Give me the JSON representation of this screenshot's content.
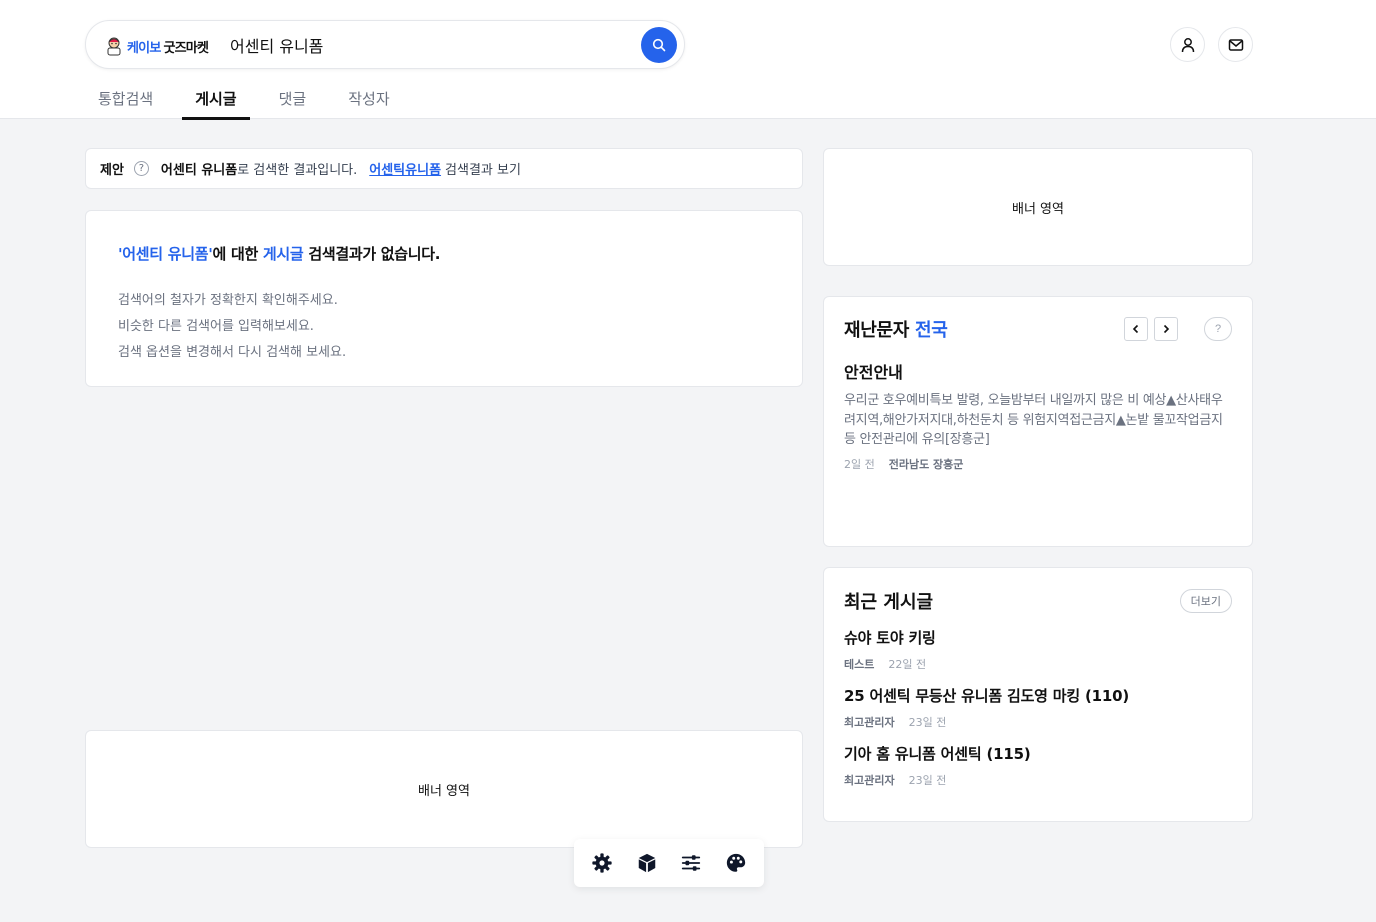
{
  "header": {
    "logo_part1": "케이보",
    "logo_part2": "굿즈마켓",
    "search_value": "어센티 유니폼"
  },
  "tabs": [
    {
      "label": "통합검색",
      "active": false
    },
    {
      "label": "게시글",
      "active": true
    },
    {
      "label": "댓글",
      "active": false
    },
    {
      "label": "작성자",
      "active": false
    }
  ],
  "suggestion": {
    "label": "제안",
    "help": "?",
    "query": "어센티 유니폼",
    "middle": "로 검색한 결과입니다.",
    "link": "어센틱유니폼",
    "tail": "검색결과 보기"
  },
  "no_result": {
    "q_open": "'",
    "query": "어센티 유니폼",
    "q_close": "'",
    "part1": "에 대한 ",
    "category": "게시글",
    "part2": " 검색결과가 없습니다.",
    "tips": [
      "검색어의 철자가 정확한지 확인해주세요.",
      "비슷한 다른 검색어를 입력해보세요.",
      "검색 옵션을 변경해서 다시 검색해 보세요."
    ]
  },
  "banner": {
    "right_label": "배너 영역",
    "left_label": "배너 영역"
  },
  "disaster": {
    "title": "재난문자",
    "region": "전국",
    "help": "?",
    "message_title": "안전안내",
    "message_body": "우리군 호우예비특보 발령, 오늘밤부터 내일까지 많은 비 예상▲산사태우려지역,해안가저지대,하천둔치 등 위험지역접근금지▲논밭 물꼬작업금지등 안전관리에 유의[장흥군]",
    "time": "2일 전",
    "location": "전라남도 장흥군"
  },
  "recent": {
    "title": "최근 게시글",
    "more": "더보기",
    "posts": [
      {
        "title": "슈야 토야 키링",
        "author": "테스트",
        "time": "22일 전"
      },
      {
        "title": "25 어센틱 무등산 유니폼 김도영 마킹 (110)",
        "author": "최고관리자",
        "time": "23일 전"
      },
      {
        "title": "기아 홈 유니폼 어센틱 (115)",
        "author": "최고관리자",
        "time": "23일 전"
      }
    ]
  },
  "toolbar": {
    "icons": [
      "gear-icon",
      "cube-icon",
      "sliders-icon",
      "palette-icon"
    ]
  },
  "colors": {
    "accent": "#2563eb",
    "background": "#f3f4f6",
    "text": "#111111",
    "muted": "#6b7280"
  }
}
